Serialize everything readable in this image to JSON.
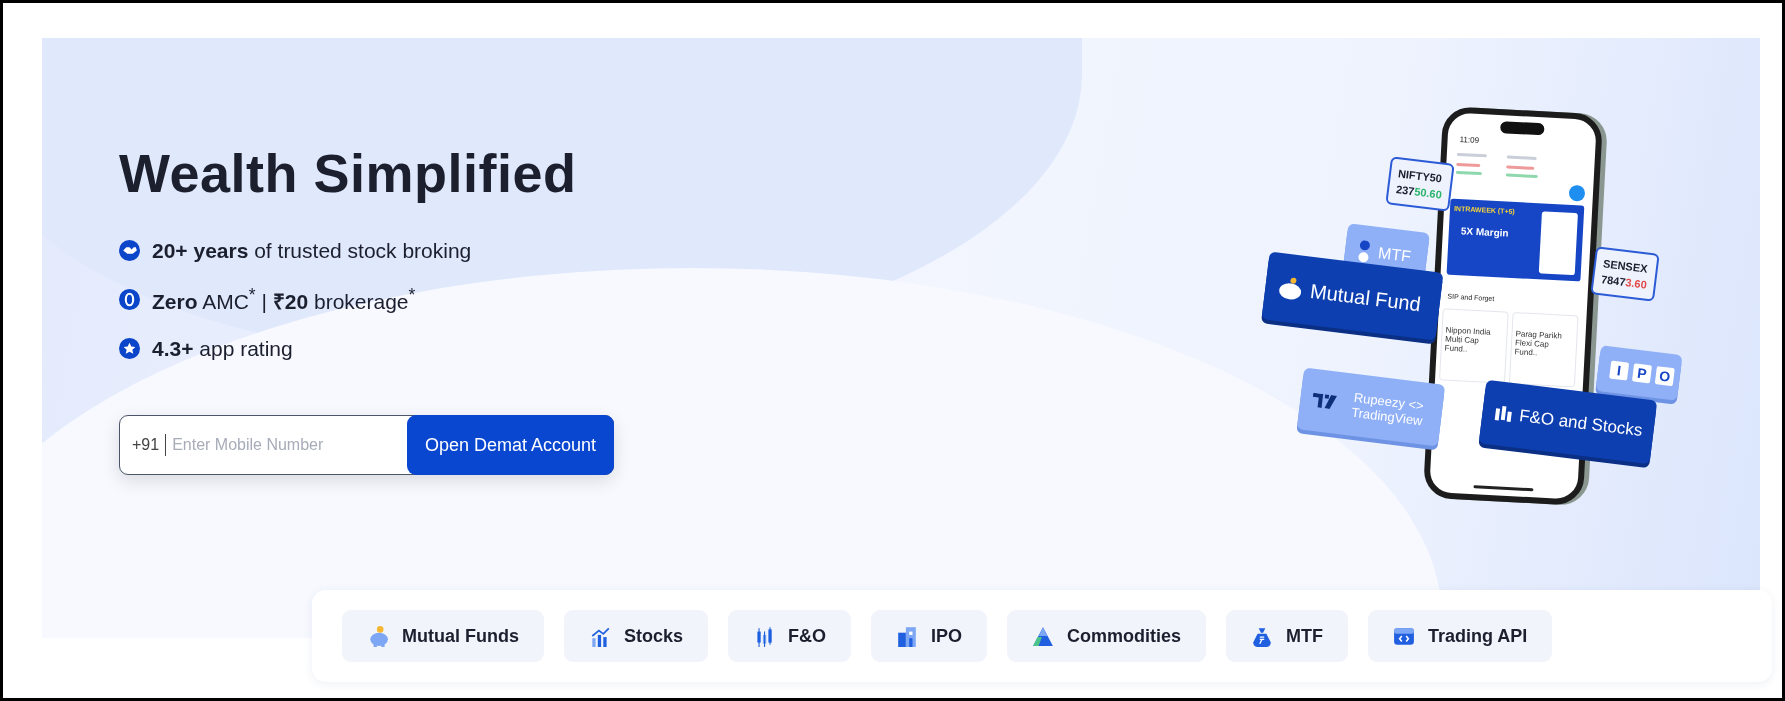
{
  "hero": {
    "title": "Wealth Simplified",
    "points": [
      {
        "kind": "handshake",
        "text": "**20+ years** of trusted stock broking"
      },
      {
        "kind": "zero",
        "text": "**Zero** AMC$^{*}$ | **₹20** brokerage$^{*}$"
      },
      {
        "kind": "star",
        "text": "**4.3+** app rating"
      }
    ],
    "form": {
      "prefix": "+91",
      "placeholder": "Enter Mobile Number",
      "button": "Open Demat Account"
    }
  },
  "illustration": {
    "phone": {
      "time": "11:09",
      "banner_title": "INTRAWEEK (T+5)",
      "banner_text": "5X Margin",
      "section": "SIP and Forget",
      "funds": [
        "Nippon India Multi Cap Fund..",
        "Parag Parikh Flexi Cap Fund.."
      ]
    },
    "tickers": [
      {
        "name": "NIFTY50",
        "value_base": "237",
        "value_change": "50.60",
        "color": "#2ab56a"
      },
      {
        "name": "SENSEX",
        "value_base": "7847",
        "value_change": "3.60",
        "color": "#e24a4a"
      }
    ],
    "cards": [
      {
        "kind": "mtf",
        "label": "MTF"
      },
      {
        "kind": "mutual-fund",
        "label": "Mutual Fund"
      },
      {
        "kind": "ipo",
        "tiles": [
          "I",
          "P",
          "O"
        ]
      },
      {
        "kind": "tradingview",
        "label": "Rupeezy <> TradingView"
      },
      {
        "kind": "fno",
        "label": "F&O and Stocks"
      }
    ]
  },
  "products": [
    {
      "kind": "piggy",
      "label": "Mutual Funds"
    },
    {
      "kind": "chart",
      "label": "Stocks"
    },
    {
      "kind": "candles",
      "label": "F&O"
    },
    {
      "kind": "building",
      "label": "IPO"
    },
    {
      "kind": "commodity",
      "label": "Commodities"
    },
    {
      "kind": "bag",
      "label": "MTF"
    },
    {
      "kind": "api",
      "label": "Trading API"
    }
  ]
}
